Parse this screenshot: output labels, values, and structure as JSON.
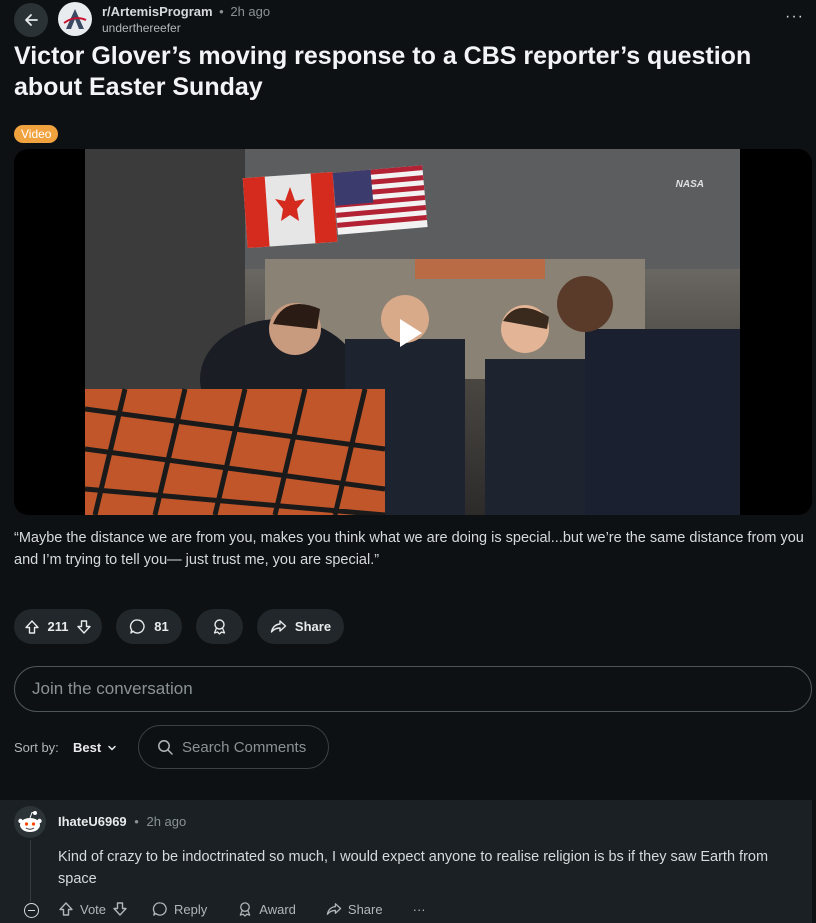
{
  "header": {
    "subreddit": "r/ArtemisProgram",
    "separator": "•",
    "time": "2h ago",
    "username": "underthereefer",
    "more": "···"
  },
  "post": {
    "title": "Victor Glover’s moving response to a CBS reporter’s question about Easter Sunday",
    "flair": "Video",
    "body": "“Maybe the distance we are from you, makes you think what we are doing is special...but we’re the same distance from you and I’m trying to tell you— just trust me, you are special.”",
    "video_watermark": "NASA"
  },
  "actions": {
    "votes": "211",
    "comments": "81",
    "share": "Share"
  },
  "comment_box": {
    "placeholder": "Join the conversation"
  },
  "sort": {
    "label": "Sort by:",
    "value": "Best",
    "search_placeholder": "Search Comments"
  },
  "comment": {
    "username": "IhateU6969",
    "separator": "•",
    "time": "2h ago",
    "body": "Kind of crazy to be indoctrinated so much, I would expect anyone to realise religion is bs if they saw Earth from space",
    "vote": "Vote",
    "reply": "Reply",
    "award": "Award",
    "share": "Share",
    "more": "···"
  },
  "colors": {
    "background": "#0e1113",
    "pill": "#21272a",
    "flair": "#f0a23e",
    "comment_bg": "#1a2024"
  }
}
